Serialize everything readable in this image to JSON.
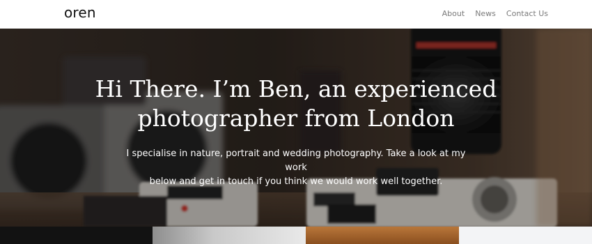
{
  "header": {
    "logo": "oren",
    "nav": [
      "About",
      "News",
      "Contact Us"
    ]
  },
  "hero": {
    "title_line1": "Hi There. I’m Ben, an experienced",
    "title_line2": "photographer from London",
    "subtitle_line1": "I specialise in nature, portrait and wedding photography. Take a look at my work",
    "subtitle_line2": "below and get in touch if you think we would work well together."
  },
  "colors": {
    "text_dark": "#111111",
    "nav_gray": "#7a7a7a",
    "hero_text": "#ffffff"
  }
}
